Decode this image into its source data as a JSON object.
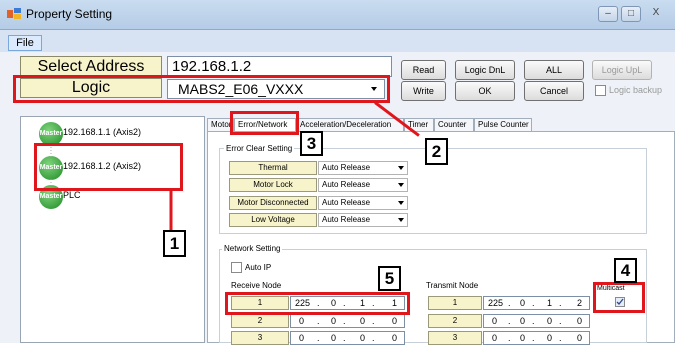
{
  "window": {
    "title": "Property Setting",
    "min": "–",
    "max": "□",
    "close": "X"
  },
  "menu": {
    "file": "File"
  },
  "controls": {
    "select_address_label": "Select Address",
    "address_value": "192.168.1.2",
    "logic_label": "Logic",
    "logic_value": "MABS2_E06_VXXX",
    "read": "Read",
    "logic_dnl": "Logic DnL",
    "all": "ALL",
    "logic_upl": "Logic UpL",
    "write": "Write",
    "ok": "OK",
    "cancel": "Cancel",
    "logic_backup": "Logic backup"
  },
  "tree": {
    "icon_text": "Master",
    "items": [
      {
        "label": "192.168.1.1 (Axis2)"
      },
      {
        "label": "192.168.1.2 (Axis2)"
      },
      {
        "label": "PLC"
      }
    ]
  },
  "tabs": [
    "Motor",
    "Error/Network",
    "Acceleration/Deceleration",
    "Timer",
    "Counter",
    "Pulse Counter"
  ],
  "error_clear": {
    "title": "Error Clear Setting",
    "rows": [
      {
        "label": "Thermal",
        "value": "Auto Release"
      },
      {
        "label": "Motor Lock",
        "value": "Auto Release"
      },
      {
        "label": "Motor Disconnected",
        "value": "Auto Release"
      },
      {
        "label": "Low Voltage",
        "value": "Auto Release"
      }
    ]
  },
  "network": {
    "title": "Network Setting",
    "auto_ip": "Auto IP",
    "receive_title": "Receive Node",
    "transmit_title": "Transmit Node",
    "multicast": "Multicast",
    "receive_rows": [
      {
        "no": "1",
        "ip": [
          "225",
          "0",
          "1",
          "1"
        ]
      },
      {
        "no": "2",
        "ip": [
          "0",
          "0",
          "0",
          "0"
        ]
      },
      {
        "no": "3",
        "ip": [
          "0",
          "0",
          "0",
          "0"
        ]
      }
    ],
    "transmit_rows": [
      {
        "no": "1",
        "ip": [
          "225",
          "0",
          "1",
          "2"
        ]
      },
      {
        "no": "2",
        "ip": [
          "0",
          "0",
          "0",
          "0"
        ]
      },
      {
        "no": "3",
        "ip": [
          "0",
          "0",
          "0",
          "0"
        ]
      }
    ]
  },
  "callouts": [
    "1",
    "2",
    "3",
    "4",
    "5"
  ],
  "colors": {
    "highlight_red": "#e0161d",
    "label_yellow": "#f7f4cc",
    "master_green": "#1e8a26"
  }
}
